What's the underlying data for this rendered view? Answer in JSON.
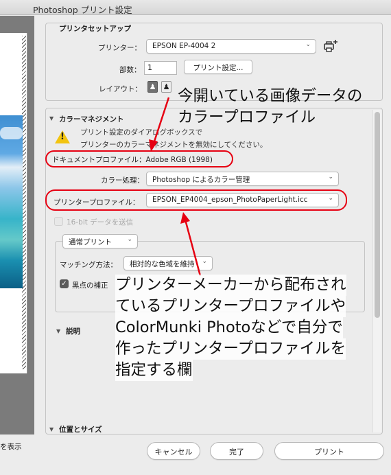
{
  "window": {
    "title": "Photoshop プリント設定"
  },
  "preview": {
    "show_label": "を表示"
  },
  "printer_setup": {
    "title": "プリンタセットアップ",
    "printer_label": "プリンター：",
    "printer_value": "EPSON EP-4004 2",
    "copies_label": "部数：",
    "copies_value": "1",
    "print_settings_button": "プリント設定...",
    "layout_label": "レイアウト："
  },
  "color_management": {
    "title": "カラーマネジメント",
    "warning_line1": "プリント設定のダイアログボックスで",
    "warning_line2": "プリンターのカラーマネジメントを無効にしてください。",
    "doc_profile": "ドキュメントプロファイル：Adobe RGB (1998)",
    "color_handling_label": "カラー処理：",
    "color_handling_value": "Photoshop によるカラー管理",
    "printer_profile_label": "プリンタープロファイル：",
    "printer_profile_value": "EPSON_EP4004_epson_PhotoPaperLight.icc",
    "sixteen_bit": "16-bit データを送信",
    "proof_setup_value": "通常プリント",
    "matching_label": "マッチング方法：",
    "matching_value": "相対的な色域を維持",
    "black_point_label": "黒点の補正"
  },
  "description": {
    "title": "説明"
  },
  "position_size": {
    "title": "位置とサイズ"
  },
  "footer": {
    "cancel": "キャンセル",
    "done": "完了",
    "print": "プリント"
  },
  "annotations": {
    "callout_top": [
      "今開いている画像データの",
      "カラープロファイル"
    ],
    "callout_bottom": [
      "プリンターメーカーから配布され",
      "ているプリンタープロファイルや",
      "ColorMunki Photoなどで自分で",
      "作ったプリンタープロファイルを",
      "指定する欄"
    ]
  },
  "colors": {
    "annotation_red": "#e60012",
    "warning_yellow": "#f2c40f"
  }
}
